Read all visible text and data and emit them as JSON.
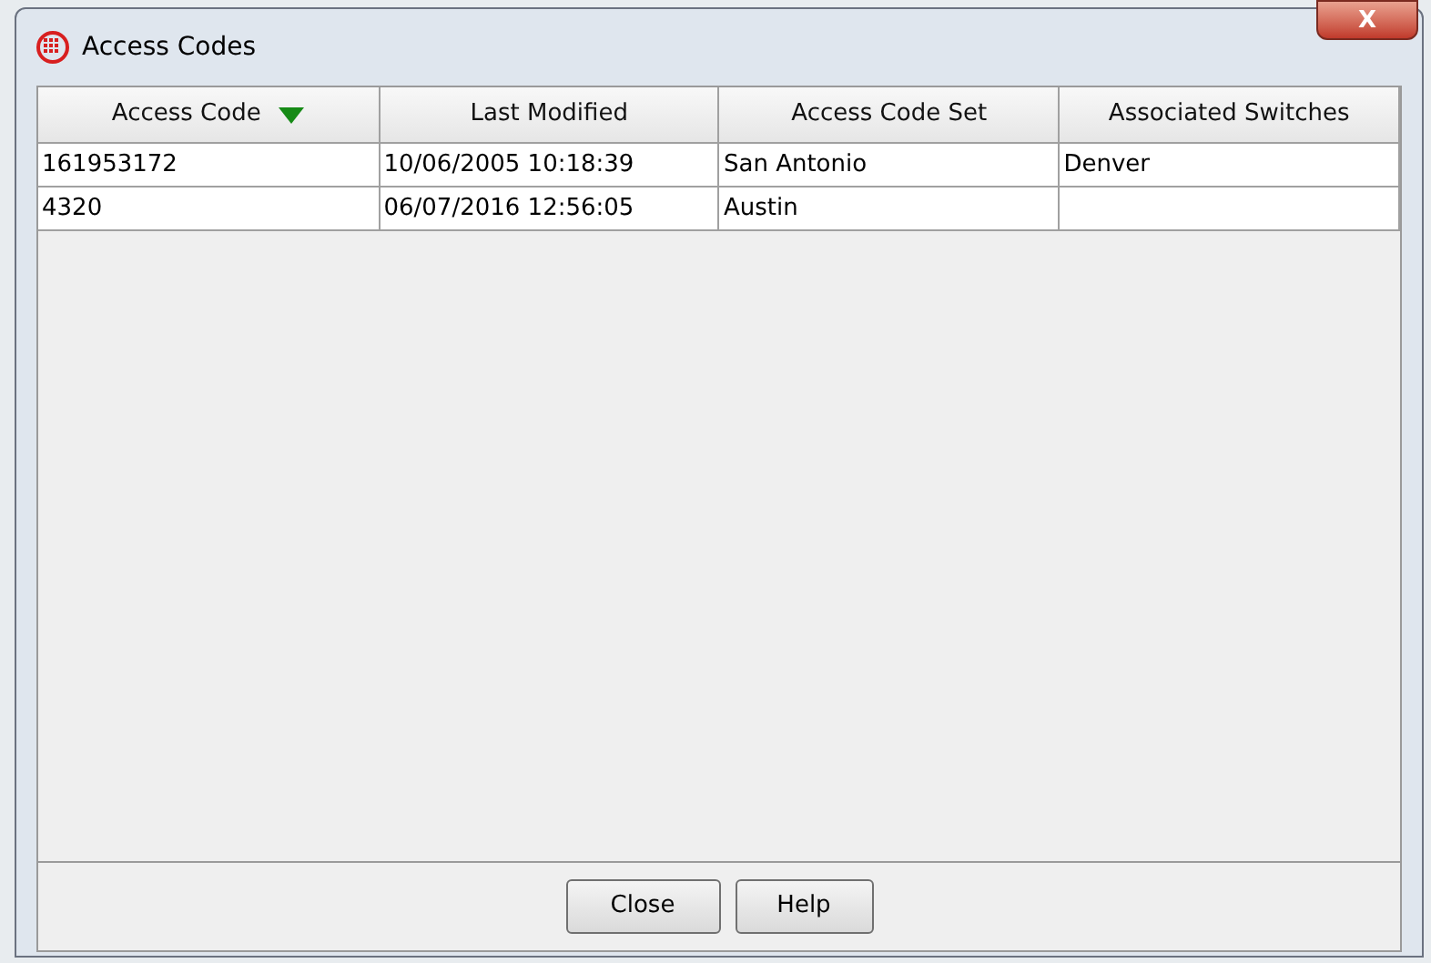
{
  "window": {
    "title": "Access Codes",
    "close_label": "X"
  },
  "table": {
    "columns": [
      {
        "label": "Access Code",
        "sorted": true
      },
      {
        "label": "Last Modified",
        "sorted": false
      },
      {
        "label": "Access Code Set",
        "sorted": false
      },
      {
        "label": "Associated Switches",
        "sorted": false
      }
    ],
    "rows": [
      [
        "161953172",
        "10/06/2005 10:18:39",
        "San Antonio",
        "Denver"
      ],
      [
        "4320",
        "06/07/2016 12:56:05",
        "Austin",
        ""
      ]
    ]
  },
  "buttons": [
    "Close",
    "Help"
  ]
}
